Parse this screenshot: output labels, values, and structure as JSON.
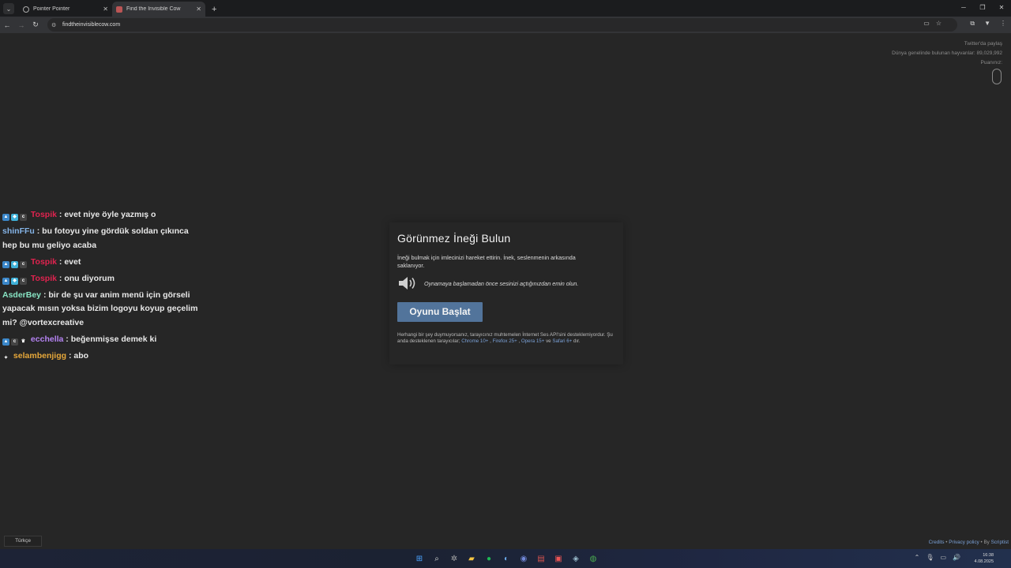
{
  "browser": {
    "tabs": [
      {
        "title": "Pointer Pointer",
        "active": false
      },
      {
        "title": "Find the Invisible Cow",
        "active": true
      }
    ],
    "url": "findtheinvisiblecow.com"
  },
  "page": {
    "share_twitter": "Twitter'da paylaş",
    "animals_found": "Dünya genelinde bulunan hayvanlar: 89,029,992",
    "score_label": "Puanınız:"
  },
  "chat": [
    {
      "user": "Tospik",
      "text": ": evet niye öyle yazmış o"
    },
    {
      "user": "shinFFu",
      "text": ": bu fotoyu yine gördük soldan çıkınca hep bu mu geliyo acaba"
    },
    {
      "user": "Tospik",
      "text": ": evet"
    },
    {
      "user": "Tospik",
      "text": ": onu diyorum"
    },
    {
      "user": "AsderBey",
      "text": ": bir de şu var anim menü için görseli yapacak mısın yoksa bizim logoyu koyup geçelim mi? @vortexcreative"
    },
    {
      "user": "ecchella",
      "text": ": beğenmişse demek ki"
    },
    {
      "user": "selambenjigg",
      "text": ": abo"
    }
  ],
  "dialog": {
    "title": "Görünmez İneği Bulun",
    "description": "İneği bulmak için imlecinizi hareket ettirin. İnek, seslenmenin arkasında saklanıyor.",
    "sound_hint": "Oynamaya başlamadan önce sesinizi açtığınızdan emin olun.",
    "start_button": "Oyunu Başlat",
    "note_prefix": "Herhangi bir şey duymuyorsanız, tarayıcınız muhtemelen İnternet Ses API'sini desteklemiyordur. Şu anda desteklenen tarayıcılar;",
    "browser_chrome": "Chrome 10+",
    "browser_firefox": "Firefox 25+",
    "browser_opera": "Opera 15+",
    "note_and": "ve",
    "browser_safari": "Safari 6+",
    "note_suffix": "dır."
  },
  "footer": {
    "language": "Türkçe",
    "credits": "Credits",
    "privacy": "Privacy policy",
    "by": "By",
    "author": "Scriptist"
  },
  "taskbar": {
    "time": "16:38",
    "date": "4.08.2025"
  }
}
